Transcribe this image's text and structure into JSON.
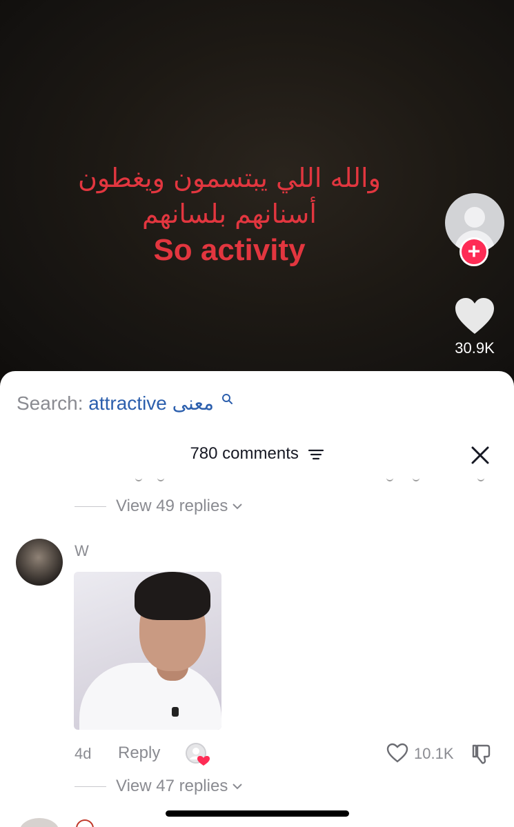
{
  "video": {
    "overlay_line1": "والله اللي يبتسمون ويغطون",
    "overlay_line2": "أسنانهم بلسانهم",
    "overlay_line3": "So activity",
    "overlay_color": "#e2363f"
  },
  "sidebar": {
    "follow_label": "+",
    "like_count": "30.9K"
  },
  "search": {
    "prefix": "Search:",
    "term": "attractive معنى"
  },
  "comments": {
    "header": "780 comments",
    "view_replies_1": "View 49 replies",
    "comment": {
      "author": "W",
      "time": "4d",
      "reply_label": "Reply",
      "likes": "10.1K"
    },
    "view_replies_2": "View 47 replies"
  },
  "colors": {
    "accent": "#fe2c55",
    "link": "#2c5fad",
    "muted": "#8a8b91"
  },
  "icons": [
    "plus-icon",
    "heart-icon",
    "search-icon",
    "sort-icon",
    "close-icon",
    "chevron-down-icon",
    "creator-liked-icon",
    "dislike-icon"
  ]
}
